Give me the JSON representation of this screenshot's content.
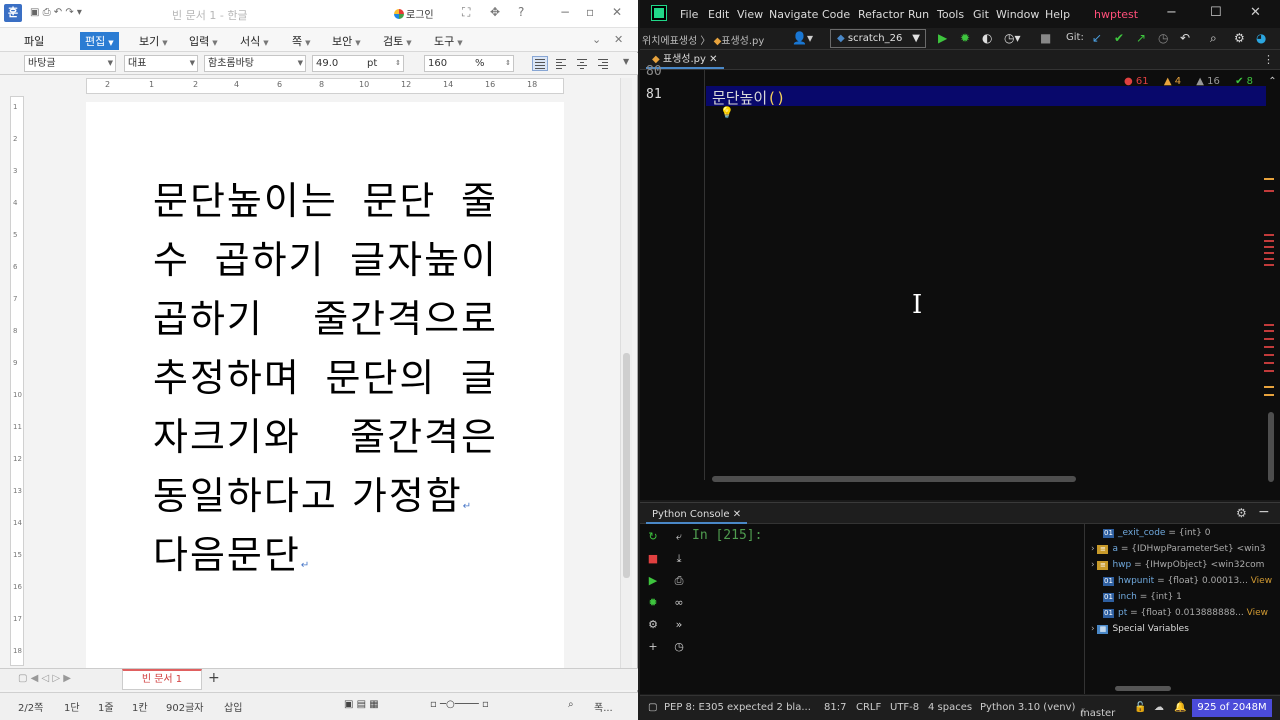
{
  "hwp": {
    "window_title": "빈 문서 1 - 한글",
    "login_label": "로그인",
    "menus": [
      "파일",
      "편집",
      "보기",
      "입력",
      "서식",
      "쪽",
      "보안",
      "검토",
      "도구"
    ],
    "format_bar": {
      "style": "바탕글",
      "font_lang": "대표",
      "font_name": "함초롬바탕",
      "font_size": "49.0",
      "size_unit": "pt",
      "line_spacing": "160",
      "line_spacing_unit": "%"
    },
    "ruler_ticks": [
      "2",
      "1",
      "2",
      "4",
      "6",
      "8",
      "10",
      "12",
      "14",
      "16",
      "18"
    ],
    "vruler_ticks": [
      "1",
      "2",
      "3",
      "4",
      "5",
      "6",
      "7",
      "8",
      "9",
      "10",
      "11",
      "12",
      "13",
      "14",
      "15",
      "16",
      "17",
      "18"
    ],
    "document_lines": [
      "문단높이는 문단 줄",
      "수 곱하기 글자높이",
      "곱하기 줄간격으로",
      "추정하며 문단의 글",
      "자크기와 줄간격은",
      "동일하다고 가정함",
      "다음문단"
    ],
    "doc_tab": "빈 문서 1",
    "status": {
      "page": "2/2쪽",
      "section": "1단",
      "line": "1줄",
      "col": "1칸",
      "chars": "902글자",
      "mode": "삽입",
      "zoom_label": "폭..."
    }
  },
  "ide": {
    "menus": [
      "File",
      "Edit",
      "View",
      "Navigate",
      "Code",
      "Refactor",
      "Run",
      "Tools",
      "Git",
      "Window",
      "Help"
    ],
    "project": "hwptest",
    "breadcrumb_1": "위치에표생성",
    "breadcrumb_2": "표생성.py",
    "run_config": "scratch_26",
    "git_label": "Git:",
    "file_tab": "표생성.py",
    "line_prev": "80",
    "line_cur": "81",
    "code_name": "문단높이",
    "code_parens": "()",
    "inspections": {
      "errors": "61",
      "warnings": "4",
      "weak": "16",
      "ok": "8"
    },
    "console_tab": "Python Console",
    "prompt": "In [215]:",
    "variables": [
      {
        "name": "_exit_code",
        "desc": " = {int} 0",
        "view": ""
      },
      {
        "name": "a",
        "desc": " = {IDHwpParameterSet} <win3",
        "view": ""
      },
      {
        "name": "hwp",
        "desc": " = {IHwpObject} <win32com",
        "view": ""
      },
      {
        "name": "hwpunit",
        "desc": " = {float} 0.00013...",
        "view": "View"
      },
      {
        "name": "inch",
        "desc": " = {int} 1",
        "view": ""
      },
      {
        "name": "pt",
        "desc": " = {float} 0.013888888...",
        "view": "View"
      },
      {
        "name": "Special Variables",
        "desc": "",
        "view": ""
      }
    ],
    "status": {
      "message": "PEP 8: E305 expected 2 bla...",
      "position": "81:7",
      "line_sep": "CRLF",
      "encoding": "UTF-8",
      "indent": "4 spaces",
      "interpreter": "Python 3.10 (venv)",
      "branch": "master",
      "memory": "925 of 2048M"
    }
  },
  "colors": {
    "hwp_accent": "#2b7cd3",
    "ide_accent": "#4a88c7",
    "current_line": "#08086b",
    "memory_bar": "#4b4bd9"
  }
}
